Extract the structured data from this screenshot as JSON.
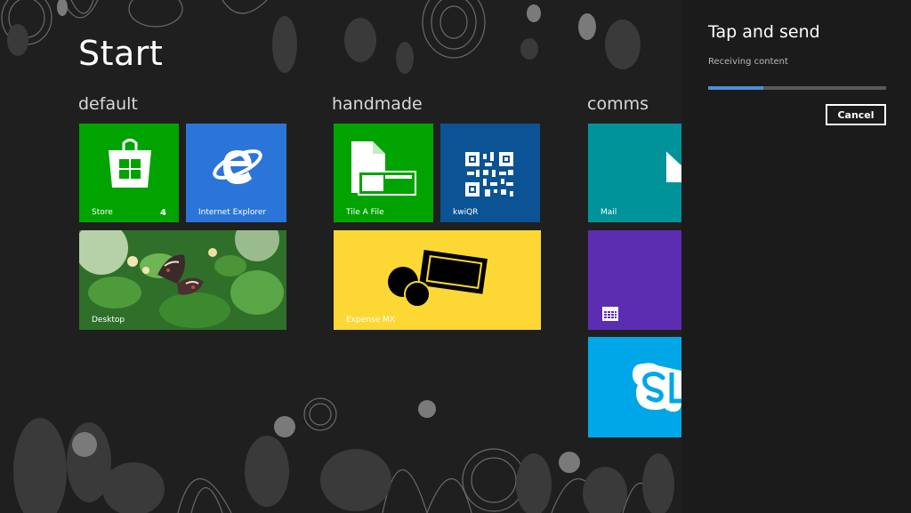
{
  "start": {
    "title": "Start",
    "groups": [
      {
        "label": "default"
      },
      {
        "label": "handmade"
      },
      {
        "label": "comms"
      }
    ],
    "tiles": {
      "store": {
        "label": "Store",
        "badge": "4",
        "color": "#00a300",
        "icon": "store-bag-icon"
      },
      "ie": {
        "label": "Internet Explorer",
        "color": "#2b75d8",
        "icon": "internet-explorer-icon"
      },
      "desktop": {
        "label": "Desktop",
        "icon": "desktop-wallpaper-butterfly"
      },
      "tile_a_file": {
        "label": "Tile A File",
        "color": "#00a300",
        "icon": "file-tile-icon"
      },
      "kwiqr": {
        "label": "kwiQR",
        "color": "#0b5394",
        "icon": "qr-code-icon"
      },
      "expense": {
        "label": "Expense MX",
        "color": "#fdd835",
        "icon": "wallet-coins-icon"
      },
      "mail": {
        "label": "Mail",
        "color": "#00949a",
        "icon": "mail-envelope-icon"
      },
      "calendar": {
        "label": "",
        "color": "#5c2db1",
        "icon": "calendar-icon"
      },
      "skype": {
        "label": "",
        "color": "#00a7e8",
        "icon": "skype-icon"
      }
    }
  },
  "charm": {
    "title": "Tap and send",
    "status": "Receiving content",
    "progress": 0.31,
    "cancel_label": "Cancel",
    "accent": "#4a90d9"
  }
}
